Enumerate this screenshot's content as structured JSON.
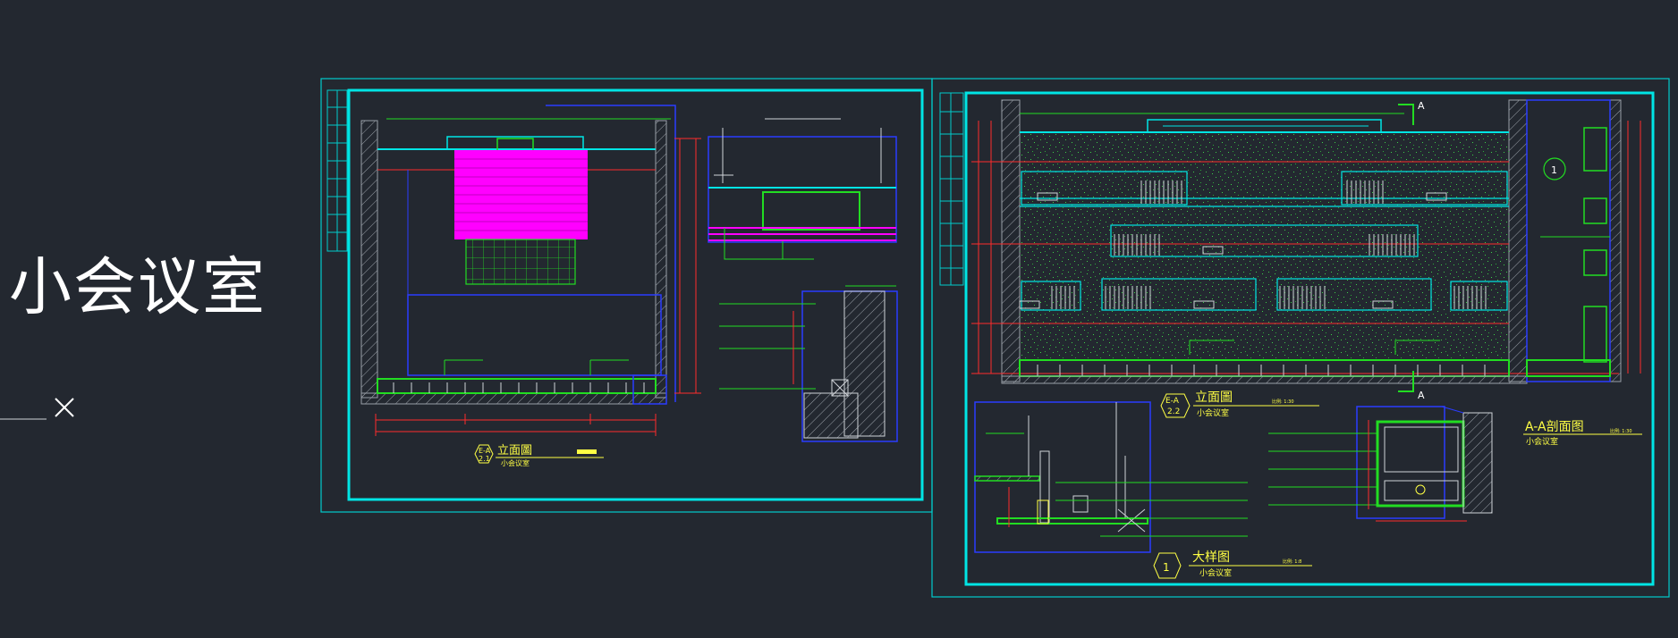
{
  "page_title": "小会议室",
  "colors": {
    "background": "#232830",
    "frame": "#00e5e5",
    "blue": "#2b3cff",
    "red": "#ff2b2b",
    "green": "#22dd22",
    "magenta": "#ff00ff",
    "yellow": "#ffff44",
    "white": "#ffffff",
    "grey": "#9aa0a8"
  },
  "sheet1": {
    "elevation_tag_top": "E-A",
    "elevation_tag_bottom": "2.1",
    "title": "立面圖",
    "subtitle": "小会议室"
  },
  "sheet2": {
    "elevation_tag_top": "E-A",
    "elevation_tag_bottom": "2.2",
    "elevation_title": "立面圖",
    "elevation_subtitle": "小会议室",
    "elevation_scale": "比例: 1:30",
    "section_marker_top": "A",
    "section_marker_bottom": "A",
    "detail_callout": "1",
    "detail_tag": "1",
    "detail_title": "大样图",
    "detail_subtitle": "小会议室",
    "detail_scale": "比例: 1:8",
    "section_title": "A-A剖面图",
    "section_subtitle": "小会议室",
    "section_scale": "比例: 1:30"
  },
  "icons": {
    "close": "close-icon"
  }
}
